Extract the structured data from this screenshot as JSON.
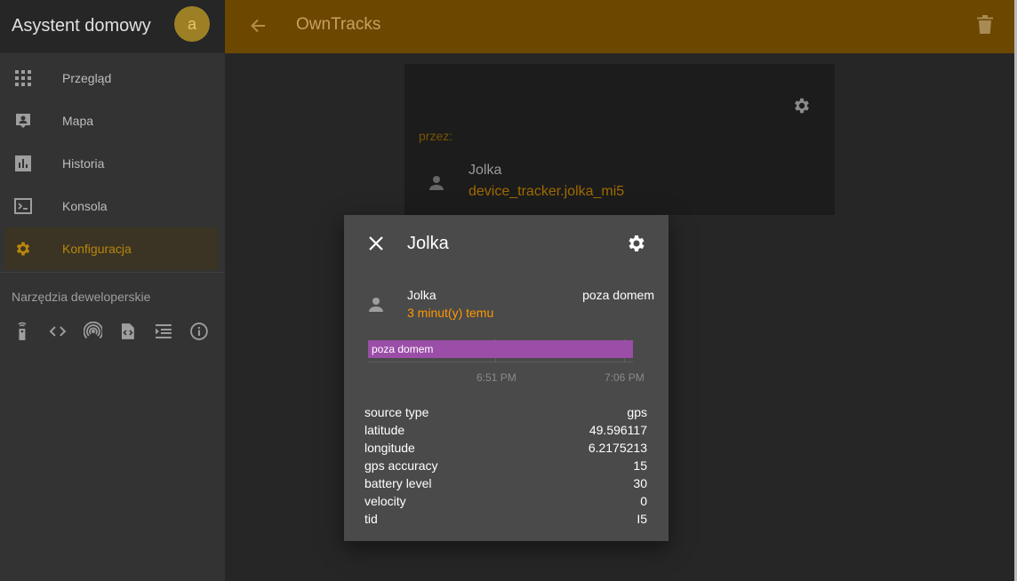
{
  "sidebar": {
    "title": "Asystent domowy",
    "avatar_letter": "a",
    "items": [
      {
        "label": "Przegląd",
        "icon": "apps-icon"
      },
      {
        "label": "Mapa",
        "icon": "map-account-icon"
      },
      {
        "label": "Historia",
        "icon": "chart-box-icon"
      },
      {
        "label": "Konsola",
        "icon": "console-icon"
      },
      {
        "label": "Konfiguracja",
        "icon": "gear-icon",
        "active": true
      }
    ],
    "dev_title": "Narzędzia deweloperskie",
    "dev_tools": [
      "remote-icon",
      "code-icon",
      "access-point-icon",
      "file-code-icon",
      "format-indent-icon",
      "info-icon"
    ]
  },
  "topbar": {
    "title": "OwnTracks"
  },
  "card": {
    "label": "przez:",
    "entity_name": "Jolka",
    "entity_id": "device_tracker.jolka_mi5"
  },
  "dialog": {
    "title": "Jolka",
    "name": "Jolka",
    "last_changed": "3 minut(y) temu",
    "state": "poza domem",
    "timeline": {
      "bar_label": "poza domem",
      "tick_1": "6:51 PM",
      "tick_2": "7:06 PM"
    },
    "attributes": [
      {
        "key": "source type",
        "value": "gps"
      },
      {
        "key": "latitude",
        "value": "49.596117"
      },
      {
        "key": "longitude",
        "value": "6.2175213"
      },
      {
        "key": "gps accuracy",
        "value": "15"
      },
      {
        "key": "battery level",
        "value": "30"
      },
      {
        "key": "velocity",
        "value": "0"
      },
      {
        "key": "tid",
        "value": "I5"
      }
    ]
  },
  "colors": {
    "accent": "#ff9800",
    "topbar": "#6b4700",
    "timeline_bar": "#9b4ea8"
  }
}
